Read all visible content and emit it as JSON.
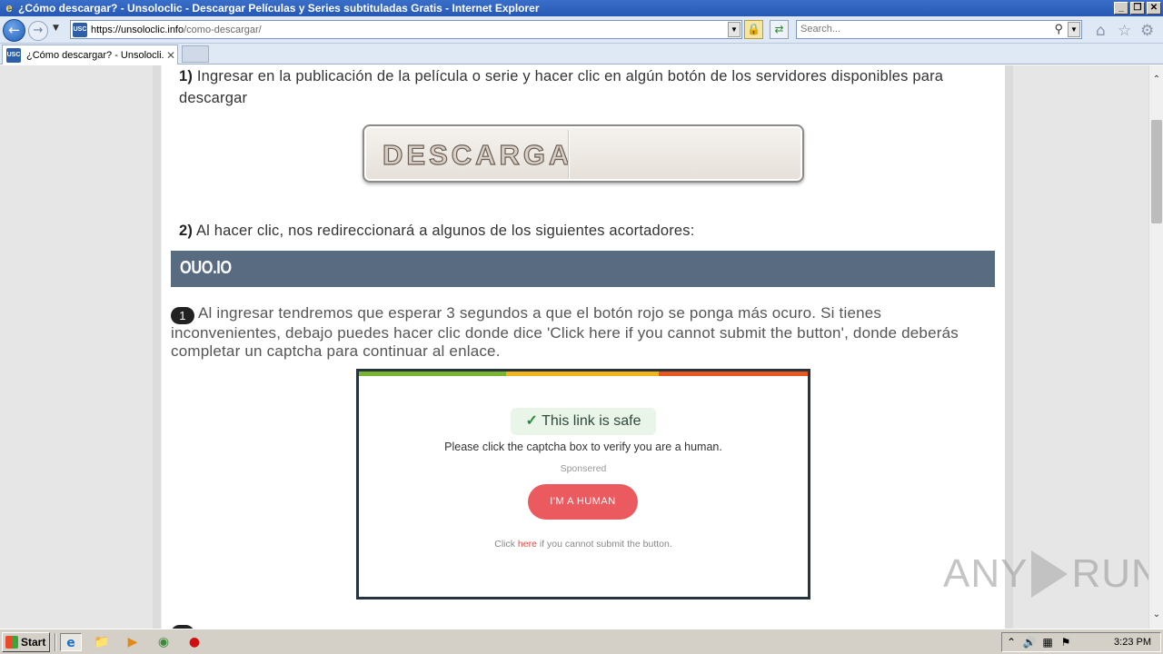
{
  "window": {
    "title": "¿Cómo descargar? - Unsoloclic - Descargar Películas y Series subtituladas Gratis - Internet Explorer",
    "buttons": [
      "_",
      "❐",
      "✕"
    ]
  },
  "addressbar": {
    "favicon_text": "USC",
    "url_host": "https://unsoloclic.info",
    "url_path": "/como-descargar/",
    "search_placeholder": "Search..."
  },
  "tab": {
    "favicon_text": "USC",
    "label": "¿Cómo descargar? - Unsolocli...",
    "close": "✕"
  },
  "page": {
    "step1_num": "1)",
    "step1_text": " Ingresar en la publicación de la película o serie y hacer clic en algún botón de los servidores disponibles para descargar",
    "descarga_label": "DESCARGA",
    "step2_num": "2)",
    "step2_text": " Al hacer clic, nos redireccionará a algunos de los siguientes acortadores:",
    "section_title": "OUO.IO",
    "para_badge": "1",
    "para_text": " Al ingresar tendremos que esperar 3 segundos a que el botón rojo se ponga más ocuro. Si tienes inconvenientes, debajo puedes hacer clic donde dice 'Click here if you cannot submit the button', donde deberás completar un captcha para continuar al enlace.",
    "ouo": {
      "check": "✓",
      "safe_text": "This link is safe",
      "message": "Please click the captcha box to verify you are a human.",
      "sponsored": "Sponsered",
      "human_button": "I'M A HUMAN",
      "foot_pre": "Click ",
      "foot_link": "here",
      "foot_post": " if you cannot submit the button.",
      "bar_colors": [
        "#79b530",
        "#f2b61c",
        "#e8571f"
      ]
    }
  },
  "watermark": {
    "left": "ANY",
    "right": "RUN"
  },
  "taskbar": {
    "start_label": "Start",
    "clock": "3:23 PM"
  },
  "colors": {
    "section_bar": "#586b80",
    "human_button": "#ea5a5f",
    "title_bar": "#2658b4"
  }
}
